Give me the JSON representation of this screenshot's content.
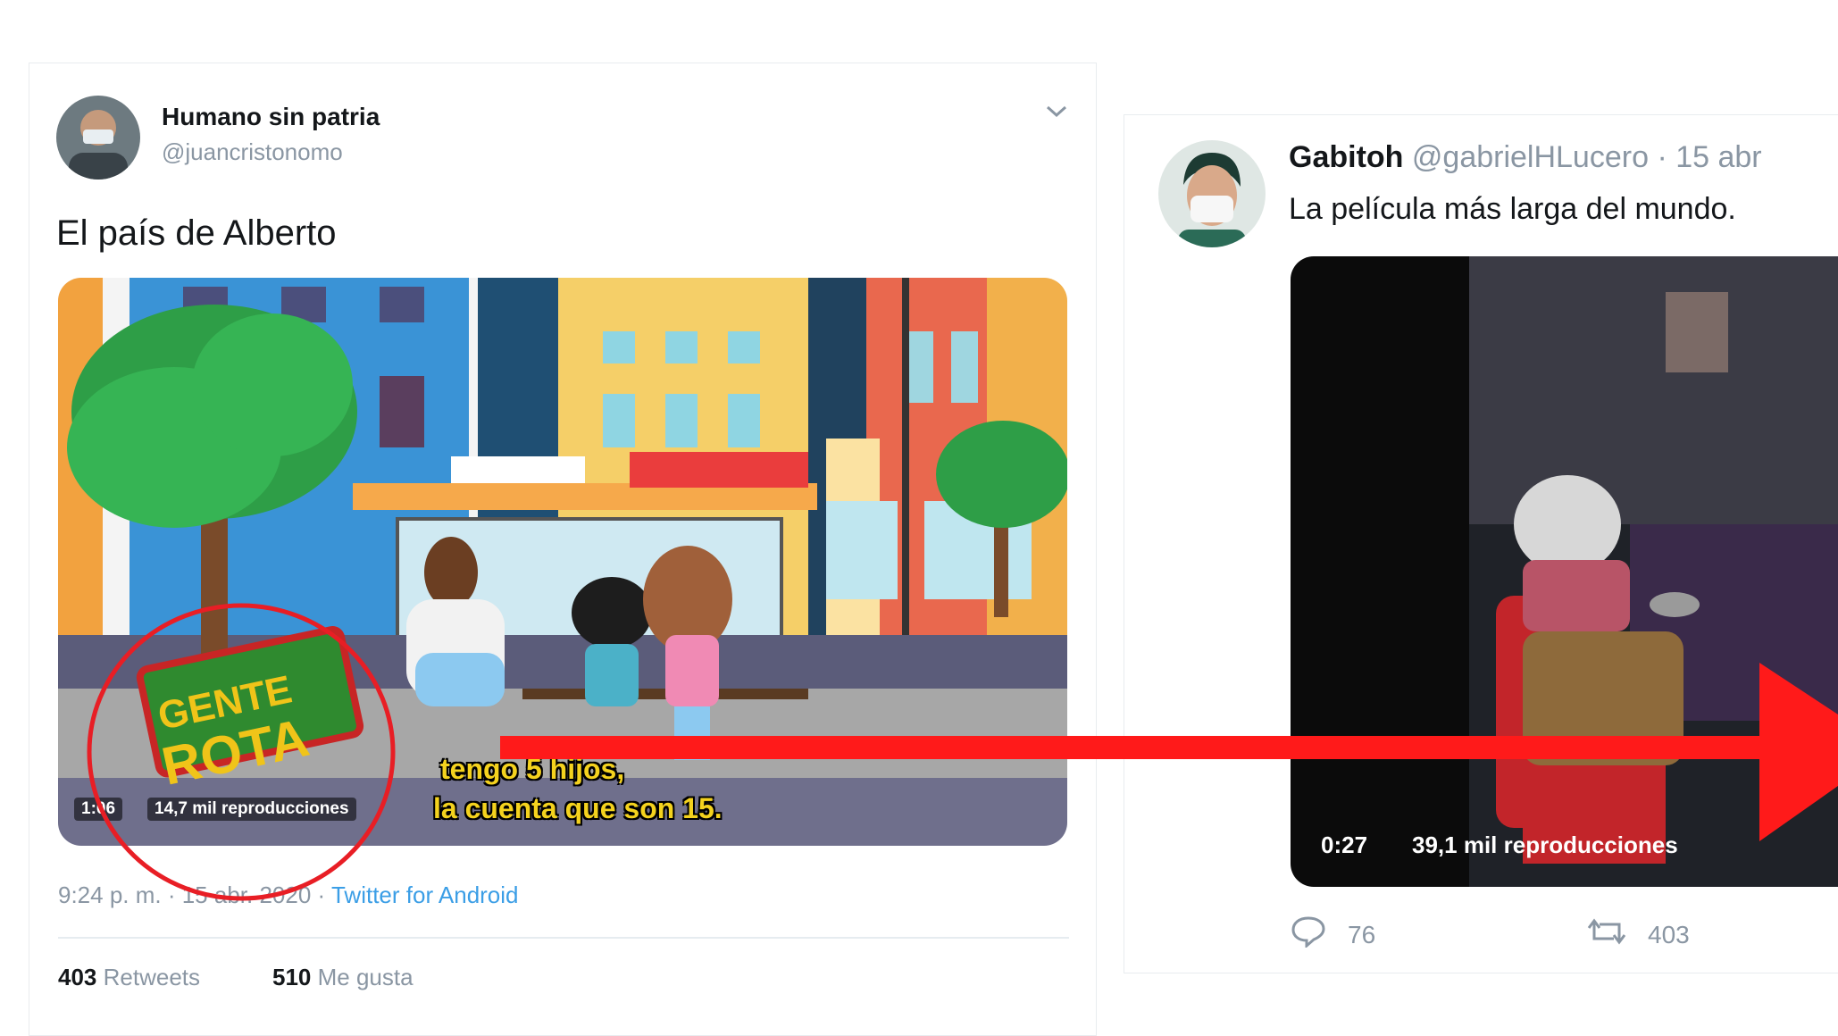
{
  "left_tweet": {
    "author_name": "Humano sin patria",
    "author_handle": "@juancristonomo",
    "text": "El país de Alberto",
    "video": {
      "duration": "1:06",
      "views": "14,7 mil reproducciones",
      "subtitle_line1": "tengo 5 hijos,",
      "subtitle_line2": "la cuenta que son 15.",
      "watermark_line1": "GENTE",
      "watermark_line2": "ROTA"
    },
    "timestamp": "9:24 p. m. · 15 abr. 2020",
    "separator": "·",
    "source": "Twitter for Android",
    "retweets_count": "403",
    "retweets_label": "Retweets",
    "likes_count": "510",
    "likes_label": "Me gusta",
    "icons": {
      "menu": "chevron-down-icon"
    }
  },
  "right_tweet": {
    "author_name": "Gabitoh",
    "author_handle": "@gabrielHLucero",
    "date": "· 15 abr",
    "text": "La película más larga del mundo.",
    "video": {
      "duration": "0:27",
      "views": "39,1 mil reproducciones"
    },
    "reply_count": "76",
    "retweet_count": "403",
    "icons": {
      "reply": "reply-icon",
      "retweet": "retweet-icon"
    }
  },
  "annotation": {
    "circle_color": "#e81e25",
    "arrow_color": "#ff1a1a"
  }
}
